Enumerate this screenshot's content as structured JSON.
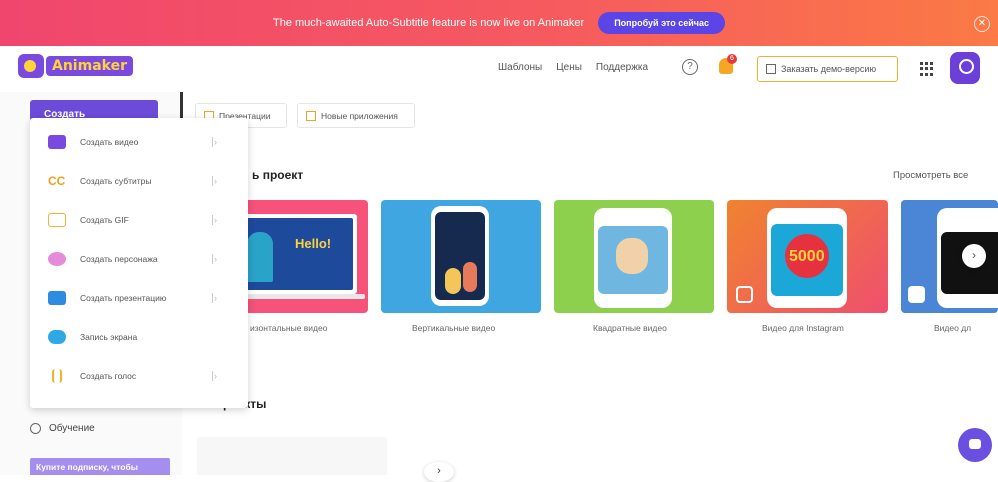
{
  "banner": {
    "message": "The much-awaited Auto-Subtitle feature is now live on Animaker",
    "button": "Попробуй это сейчас"
  },
  "header": {
    "logo": "Animaker",
    "nav": [
      "Шаблоны",
      "Цены",
      "Поддержка"
    ],
    "help": "?",
    "notifications": "6",
    "demo_button": "Заказать демо-версию"
  },
  "sidebar": {
    "create_button": "Создать",
    "learning": "Обучение",
    "subscribe": "Купите подписку, чтобы"
  },
  "dropdown": {
    "items": [
      {
        "label": "Создать видео",
        "icon": "video-icon"
      },
      {
        "label": "Создать субтитры",
        "icon": "subtitles-icon"
      },
      {
        "label": "Создать GIF",
        "icon": "gif-icon"
      },
      {
        "label": "Создать персонажа",
        "icon": "character-icon"
      },
      {
        "label": "Создать презентацию",
        "icon": "presentation-icon"
      },
      {
        "label": "Запись экрана",
        "icon": "screen-record-icon"
      },
      {
        "label": "Создать голос",
        "icon": "voice-icon"
      }
    ]
  },
  "tabs": [
    "Презентации",
    "Новые приложения"
  ],
  "create_project": {
    "title": "ь проект",
    "view_all": "Просмотреть все",
    "cards": [
      {
        "label": "изонтальные видео",
        "screen_text": "Hello!"
      },
      {
        "label": "Вертикальные видео"
      },
      {
        "label": "Квадратные видео"
      },
      {
        "label": "Видео для Instagram",
        "screen_text": "5000"
      },
      {
        "label": "Видео дл"
      }
    ]
  },
  "my_projects": {
    "title": "...и проекты"
  },
  "colors": {
    "accent": "#6c4bd9",
    "banner_start": "#f0466e",
    "banner_end": "#fb7a45"
  }
}
